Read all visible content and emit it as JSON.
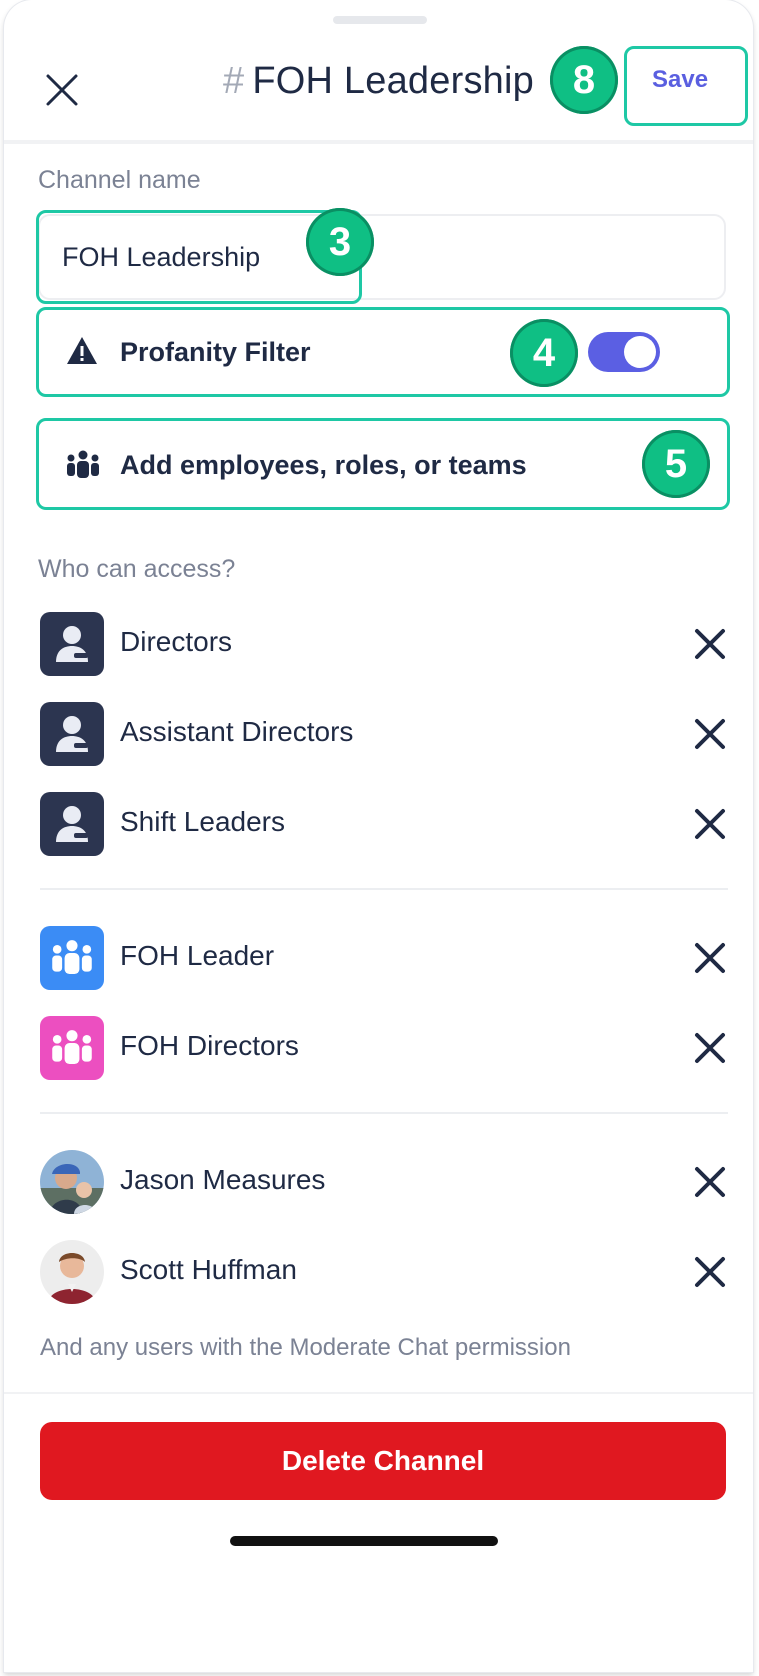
{
  "header": {
    "hash": "#",
    "title": "FOH Leadership",
    "save_label": "Save"
  },
  "markers": {
    "save": "8",
    "name": "3",
    "filter": "4",
    "add": "5"
  },
  "channel_name": {
    "label": "Channel name",
    "value": "FOH Leadership"
  },
  "profanity_filter": {
    "label": "Profanity Filter",
    "enabled": true
  },
  "add_members": {
    "label": "Add employees, roles, or teams"
  },
  "access": {
    "label": "Who can access?",
    "roles": [
      {
        "name": "Directors"
      },
      {
        "name": "Assistant Directors"
      },
      {
        "name": "Shift Leaders"
      }
    ],
    "teams": [
      {
        "name": "FOH Leader",
        "color": "#3b8cf5"
      },
      {
        "name": "FOH Directors",
        "color": "#ec4fc0"
      }
    ],
    "users": [
      {
        "name": "Jason Measures"
      },
      {
        "name": "Scott Huffman"
      }
    ],
    "note": "And any users with the Moderate Chat permission"
  },
  "delete_label": "Delete Channel",
  "colors": {
    "accent": "#5b5fe3",
    "highlight": "#1ec8a5",
    "marker": "#0fbf84",
    "danger": "#e01820"
  }
}
